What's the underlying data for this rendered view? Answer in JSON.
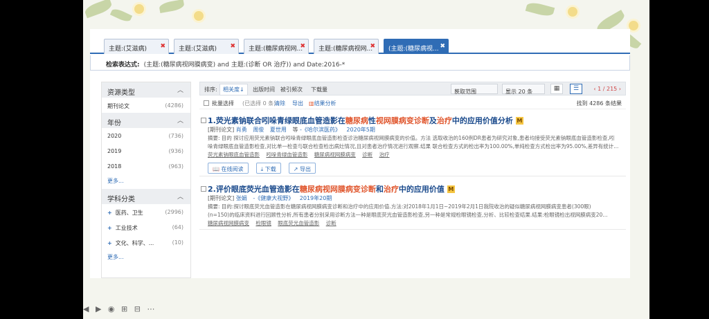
{
  "tabs": [
    {
      "label": "主题:(艾滋病)"
    },
    {
      "label": "主题:(艾滋病)"
    },
    {
      "label": "主题:(糖尿病视网..."
    },
    {
      "label": "主题:(糖尿病视网..."
    },
    {
      "label": "(主题:(糖尿病视..."
    }
  ],
  "search_expression": {
    "label": "检索表达式:",
    "value": "(主题:(糖尿病视网膜病变) and 主题:(诊断 OR 治疗)) and Date:2016-*"
  },
  "sidebar": {
    "resource_type": {
      "title": "资源类型",
      "items": [
        {
          "label": "期刊论文",
          "count": "(4286)"
        }
      ]
    },
    "year": {
      "title": "年份",
      "items": [
        {
          "label": "2020",
          "count": "(736)"
        },
        {
          "label": "2019",
          "count": "(936)"
        },
        {
          "label": "2018",
          "count": "(963)"
        }
      ],
      "more": "更多..."
    },
    "subject": {
      "title": "学科分类",
      "items": [
        {
          "label": "医药、卫生",
          "count": "(2996)"
        },
        {
          "label": "工业技术",
          "count": "(64)"
        },
        {
          "label": "文化、科学、...",
          "count": "(10)"
        }
      ],
      "more": "更多..."
    }
  },
  "toolbar": {
    "sort_label": "排序:",
    "sort_options": [
      "相关度↓",
      "出版时间",
      "被引频次",
      "下载量"
    ],
    "scope": "获取范围",
    "page_size": "显示 20 条",
    "pager": "‹ 1 / 215 ›"
  },
  "batch": {
    "select_all": "批量选择",
    "selected": "(已选择 0 条)",
    "clear": "清除",
    "export": "导出",
    "analysis": "结果分析",
    "found": "找到 4286 条结果"
  },
  "results": [
    {
      "title_parts": [
        {
          "t": "1.荧光素钠联合吲哚青绿眼底血管造影在",
          "h": false
        },
        {
          "t": "糖尿病",
          "h": true
        },
        {
          "t": "性",
          "h": false
        },
        {
          "t": "视网膜病变诊断",
          "h": true
        },
        {
          "t": "及",
          "h": false
        },
        {
          "t": "治疗",
          "h": true
        },
        {
          "t": "中的应用价值分析",
          "h": false
        }
      ],
      "type": "[期刊论文]",
      "authors": [
        "肖勇",
        "周俊",
        "夏世用"
      ],
      "etal": "等",
      "journal": "-《哈尔滨医药》",
      "date": "2020年5期",
      "abstract_1": "摘要: 目的 探讨应用荧光素钠联合吲哚青绿眼底血管造影检查诊治糖尿病视网膜病变的价值。方法 选取收治的160例DR患者为研究对象,患者均接受荧光素钠眼底血管造影检查,吲",
      "abstract_2": "哚青绿眼底血管造影检查,对比单一检查与联合检查检出病灶情况,且对患者治疗情况进行观察.结果 联合检查方式的检出率为100.00%,单纯检查方式检出率为95.00%,差异有统计...",
      "keywords": [
        "荧光素钠眼底血管造影",
        "吲哚青绿血管造影",
        "糖尿病视网膜病变",
        "诊断",
        "治疗"
      ],
      "actions": [
        "在线阅读",
        "下载",
        "导出"
      ]
    },
    {
      "title_parts": [
        {
          "t": "2.评价眼底荧光血管造影在",
          "h": false
        },
        {
          "t": "糖尿病视网膜病变诊断",
          "h": true
        },
        {
          "t": "和",
          "h": false
        },
        {
          "t": "治疗",
          "h": true
        },
        {
          "t": "中的应用价值",
          "h": false
        }
      ],
      "type": "[期刊论文]",
      "authors": [
        "张娟"
      ],
      "etal": "",
      "journal": "-《健康大视野》",
      "date": "2019年20期",
      "abstract_1": "摘要: 目的:探讨眼底荧光血管造影在糖尿病视网膜病变诊断和治疗中的应用价值.方法:对2018年1月1日~2019年2月1日我院收治的疑似糖尿病视网膜病变患者(300眼)",
      "abstract_2": "(n=150)的临床资料进行回顾性分析,所有患者分别采用诊断方法一种是眼底荧光血管造影检查,另一种是常规检眼镜检查,分析、比较检查结果.结果:检眼镜检出视网膜病变20...",
      "keywords": [
        "糖尿病视网膜病变",
        "检眼镜",
        "眼底荧光血管造影",
        "诊断"
      ],
      "actions": []
    }
  ],
  "bottom_controls": "◀ ▶ ◉ ⊞ ⊟ ⋯"
}
